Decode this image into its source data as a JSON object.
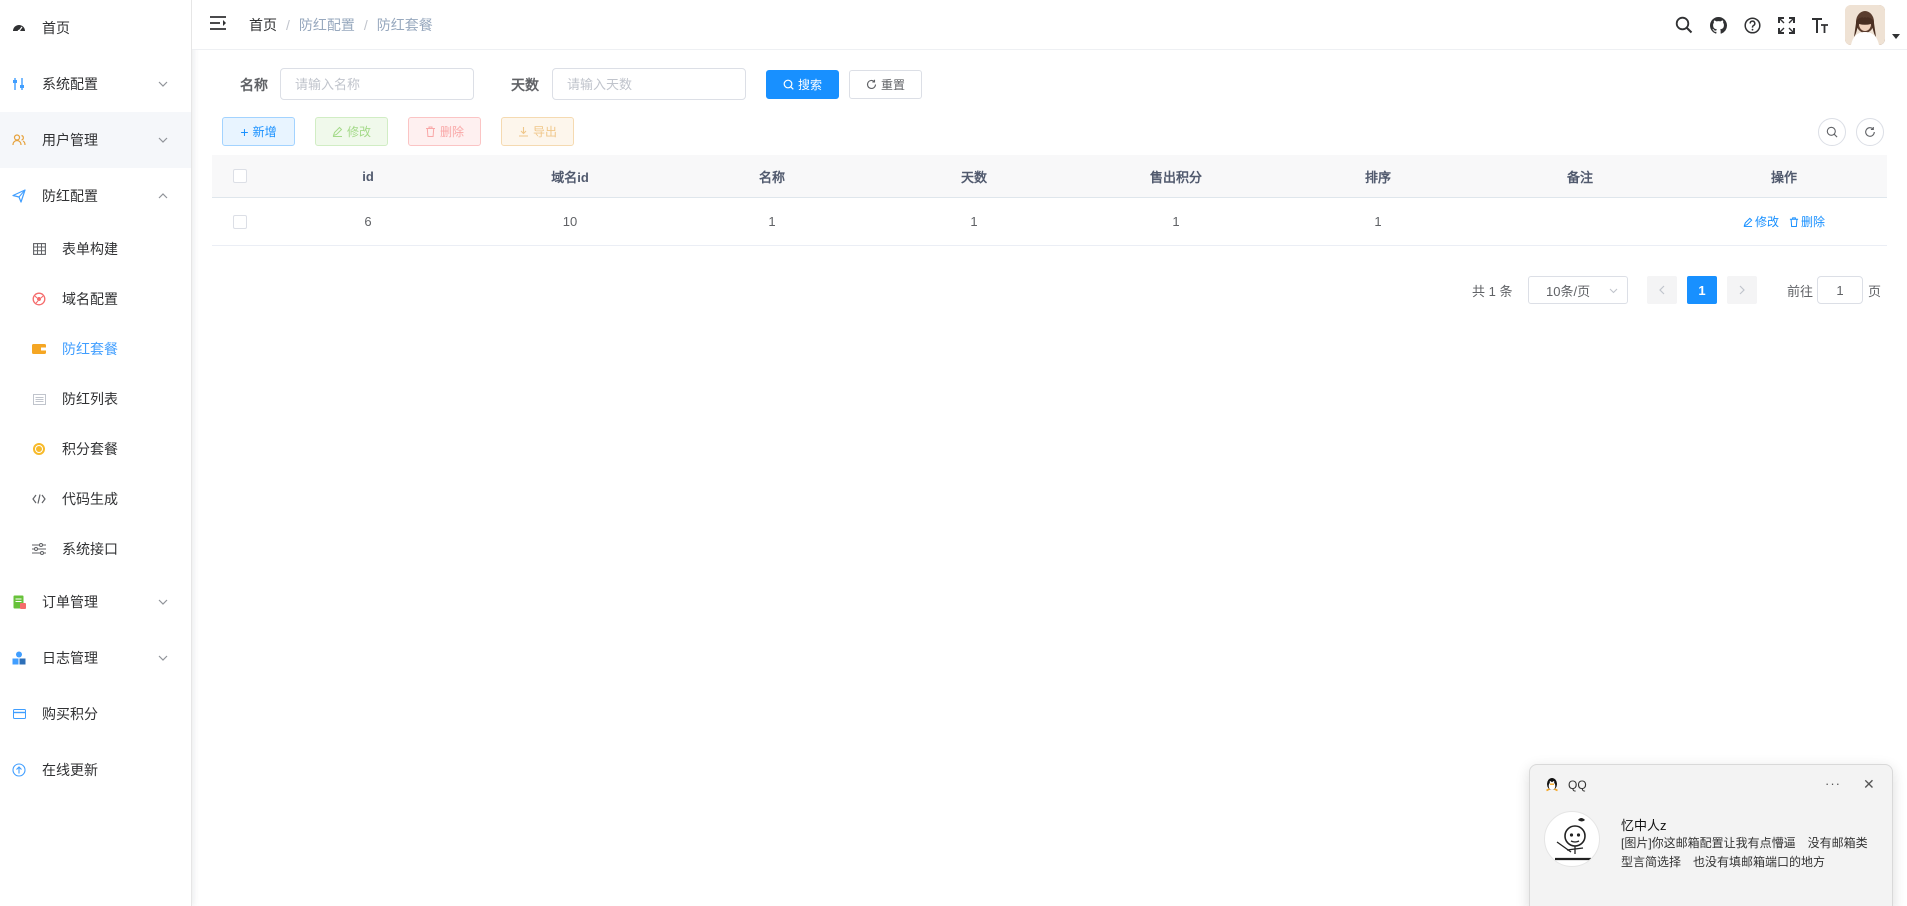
{
  "sidebar": {
    "items": [
      {
        "label": "首页"
      },
      {
        "label": "系统配置"
      },
      {
        "label": "用户管理"
      },
      {
        "label": "防红配置"
      },
      {
        "label": "表单构建"
      },
      {
        "label": "域名配置"
      },
      {
        "label": "防红套餐"
      },
      {
        "label": "防红列表"
      },
      {
        "label": "积分套餐"
      },
      {
        "label": "代码生成"
      },
      {
        "label": "系统接口"
      },
      {
        "label": "订单管理"
      },
      {
        "label": "日志管理"
      },
      {
        "label": "购买积分"
      },
      {
        "label": "在线更新"
      }
    ]
  },
  "header": {
    "breadcrumb": [
      "首页",
      "防红配置",
      "防红套餐"
    ],
    "separator": "/"
  },
  "search": {
    "name_label": "名称",
    "name_placeholder": "请输入名称",
    "days_label": "天数",
    "days_placeholder": "请输入天数",
    "search_button": "搜索",
    "reset_button": "重置"
  },
  "toolbar": {
    "add": "新增",
    "edit": "修改",
    "delete": "删除",
    "export": "导出"
  },
  "table": {
    "columns": [
      "id",
      "域名id",
      "名称",
      "天数",
      "售出积分",
      "排序",
      "备注",
      "操作"
    ],
    "rows": [
      {
        "id": "6",
        "domain_id": "10",
        "name": "1",
        "days": "1",
        "points": "1",
        "sort": "1",
        "remark": "",
        "edit": "修改",
        "delete": "删除"
      }
    ]
  },
  "pagination": {
    "total": "共 1 条",
    "page_size": "10条/页",
    "current_page": "1",
    "goto_label": "前往",
    "goto_value": "1",
    "page_suffix": "页"
  },
  "notification": {
    "app": "QQ",
    "sender": "忆中人z",
    "message": "[图片]你这邮箱配置让我有点懵逼　没有邮箱类型言简选择　也没有填邮箱端口的地方",
    "more": "···",
    "close": "✕"
  },
  "colors": {
    "primary": "#1890ff",
    "active_menu": "#409eff"
  }
}
